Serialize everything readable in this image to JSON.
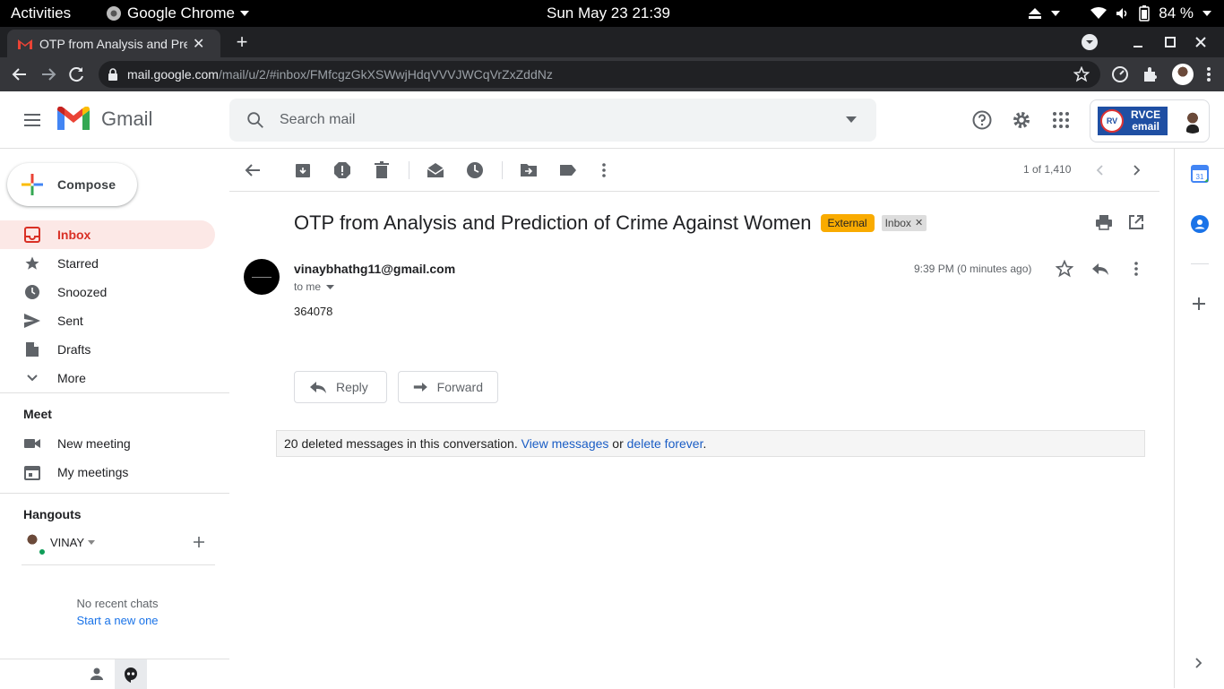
{
  "system_bar": {
    "activities": "Activities",
    "app_name": "Google Chrome",
    "clock": "Sun May 23  21:39",
    "battery": "84 %"
  },
  "browser": {
    "tab_title": "OTP from Analysis and Prediction of Crime Against Women",
    "url_host": "mail.google.com",
    "url_path": "/mail/u/2/#inbox/FMfcgzGkXSWwjHdqVVVJWCqVrZxZddNz"
  },
  "gmail": {
    "logo_text": "Gmail",
    "search_placeholder": "Search mail",
    "account_badge_line1": "RVCE",
    "account_badge_line2": "email"
  },
  "sidebar": {
    "compose_label": "Compose",
    "items": [
      {
        "label": "Inbox",
        "icon": "inbox-icon",
        "active": true
      },
      {
        "label": "Starred",
        "icon": "star-icon"
      },
      {
        "label": "Snoozed",
        "icon": "clock-icon"
      },
      {
        "label": "Sent",
        "icon": "send-icon"
      },
      {
        "label": "Drafts",
        "icon": "draft-icon"
      },
      {
        "label": "More",
        "icon": "chevron-down-icon"
      }
    ],
    "meet": {
      "title": "Meet",
      "new_meeting": "New meeting",
      "my_meetings": "My meetings"
    },
    "hangouts": {
      "title": "Hangouts",
      "user": "VINAY",
      "no_chats": "No recent chats",
      "start_new": "Start a new one"
    }
  },
  "toolbar": {
    "pager": "1 of 1,410"
  },
  "message": {
    "subject": "OTP from Analysis and Prediction of Crime Against Women",
    "label_external": "External",
    "label_inbox": "Inbox",
    "sender": "vinaybhathg11@gmail.com",
    "recipient": "to me",
    "time": "9:39 PM (0 minutes ago)",
    "body": "364078",
    "reply_label": "Reply",
    "forward_label": "Forward",
    "deleted_notice_prefix": "20 deleted messages in this conversation.",
    "view_messages": "View messages",
    "or_text": "or",
    "delete_forever": "delete forever",
    "period": "."
  },
  "colors": {
    "accent_red": "#d93025",
    "active_bg": "#fce8e6",
    "external_badge": "#f9ab00",
    "link_blue": "#1a5dc5"
  }
}
